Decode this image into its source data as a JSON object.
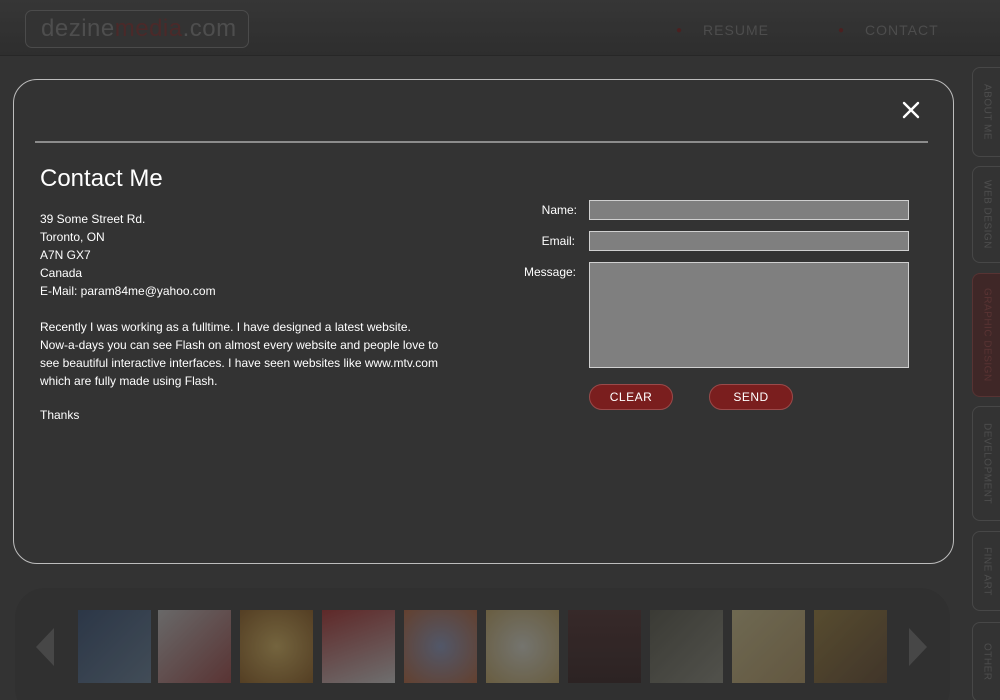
{
  "header": {
    "logo_part1": "dezine",
    "logo_part2": "media",
    "logo_part3": ".com",
    "nav": [
      "RESUME",
      "CONTACT"
    ]
  },
  "side_tabs": [
    "ABOUT ME",
    "WEB DESIGN",
    "GRAPHIC DESIGN",
    "DEVELOPMENT",
    "FINE ART",
    "OTHER"
  ],
  "modal": {
    "title": "Contact Me",
    "address": [
      "39 Some Street Rd.",
      "Toronto, ON",
      "A7N GX7",
      "Canada",
      "E-Mail: param84me@yahoo.com"
    ],
    "paragraph": "Recently I was working as a fulltime. I have designed a latest website. Now-a-days you can see Flash on almost every website and people love to see beautiful interactive interfaces. I have seen websites like www.mtv.com which are fully made using Flash.",
    "thanks": "Thanks",
    "form": {
      "name_label": "Name:",
      "email_label": "Email:",
      "message_label": "Message:",
      "name_value": "",
      "email_value": "",
      "message_value": "",
      "clear_label": "CLEAR",
      "send_label": "SEND"
    }
  },
  "colors": {
    "accent": "#7a1e1e",
    "modal_bg": "#333333",
    "field_bg": "#7f7f7f"
  }
}
